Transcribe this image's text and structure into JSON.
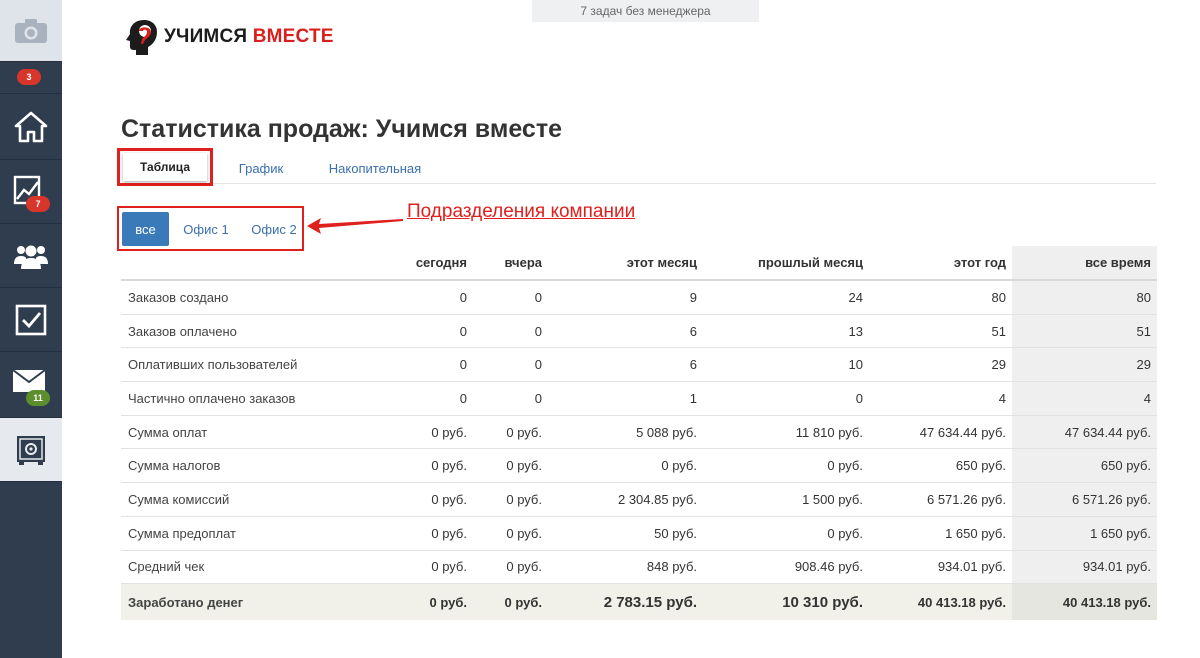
{
  "sidebar": {
    "camera_badge": "3",
    "stats_badge": "7",
    "mail_badge": "11"
  },
  "top_notice": "7 задач без менеджера",
  "logo": {
    "word1": "УЧИМСЯ",
    "word2": "ВМЕСТЕ"
  },
  "page_title": "Статистика продаж: Учимся вместе",
  "tabs": {
    "table": "Таблица",
    "graph": "График",
    "cumulative": "Накопительная"
  },
  "filters": {
    "all": "все",
    "office1": "Офис 1",
    "office2": "Офис 2"
  },
  "annotation": "Подразделения компании",
  "table": {
    "headers": [
      "",
      "сегодня",
      "вчера",
      "этот месяц",
      "прошлый месяц",
      "этот год",
      "все время"
    ],
    "rows": [
      [
        "Заказов создано",
        "0",
        "0",
        "9",
        "24",
        "80",
        "80"
      ],
      [
        "Заказов оплачено",
        "0",
        "0",
        "6",
        "13",
        "51",
        "51"
      ],
      [
        "Оплативших пользователей",
        "0",
        "0",
        "6",
        "10",
        "29",
        "29"
      ],
      [
        "Частично оплачено заказов",
        "0",
        "0",
        "1",
        "0",
        "4",
        "4"
      ],
      [
        "Сумма оплат",
        "0 руб.",
        "0 руб.",
        "5 088 руб.",
        "11 810 руб.",
        "47 634.44 руб.",
        "47 634.44 руб."
      ],
      [
        "Сумма налогов",
        "0 руб.",
        "0 руб.",
        "0 руб.",
        "0 руб.",
        "650 руб.",
        "650 руб."
      ],
      [
        "Сумма комиссий",
        "0 руб.",
        "0 руб.",
        "2 304.85 руб.",
        "1 500 руб.",
        "6 571.26 руб.",
        "6 571.26 руб."
      ],
      [
        "Сумма предоплат",
        "0 руб.",
        "0 руб.",
        "50 руб.",
        "0 руб.",
        "1 650 руб.",
        "1 650 руб."
      ],
      [
        "Средний чек",
        "0 руб.",
        "0 руб.",
        "848 руб.",
        "908.46 руб.",
        "934.01 руб.",
        "934.01 руб."
      ]
    ],
    "total": [
      "Заработано денег",
      "0 руб.",
      "0 руб.",
      "2 783.15 руб.",
      "10 310 руб.",
      "40 413.18 руб.",
      "40 413.18 руб."
    ]
  },
  "colors": {
    "sidebar": "#2f3d4f",
    "accent": "#3b7ab8",
    "highlight": "#e0201d",
    "brand_red": "#d9201f"
  }
}
